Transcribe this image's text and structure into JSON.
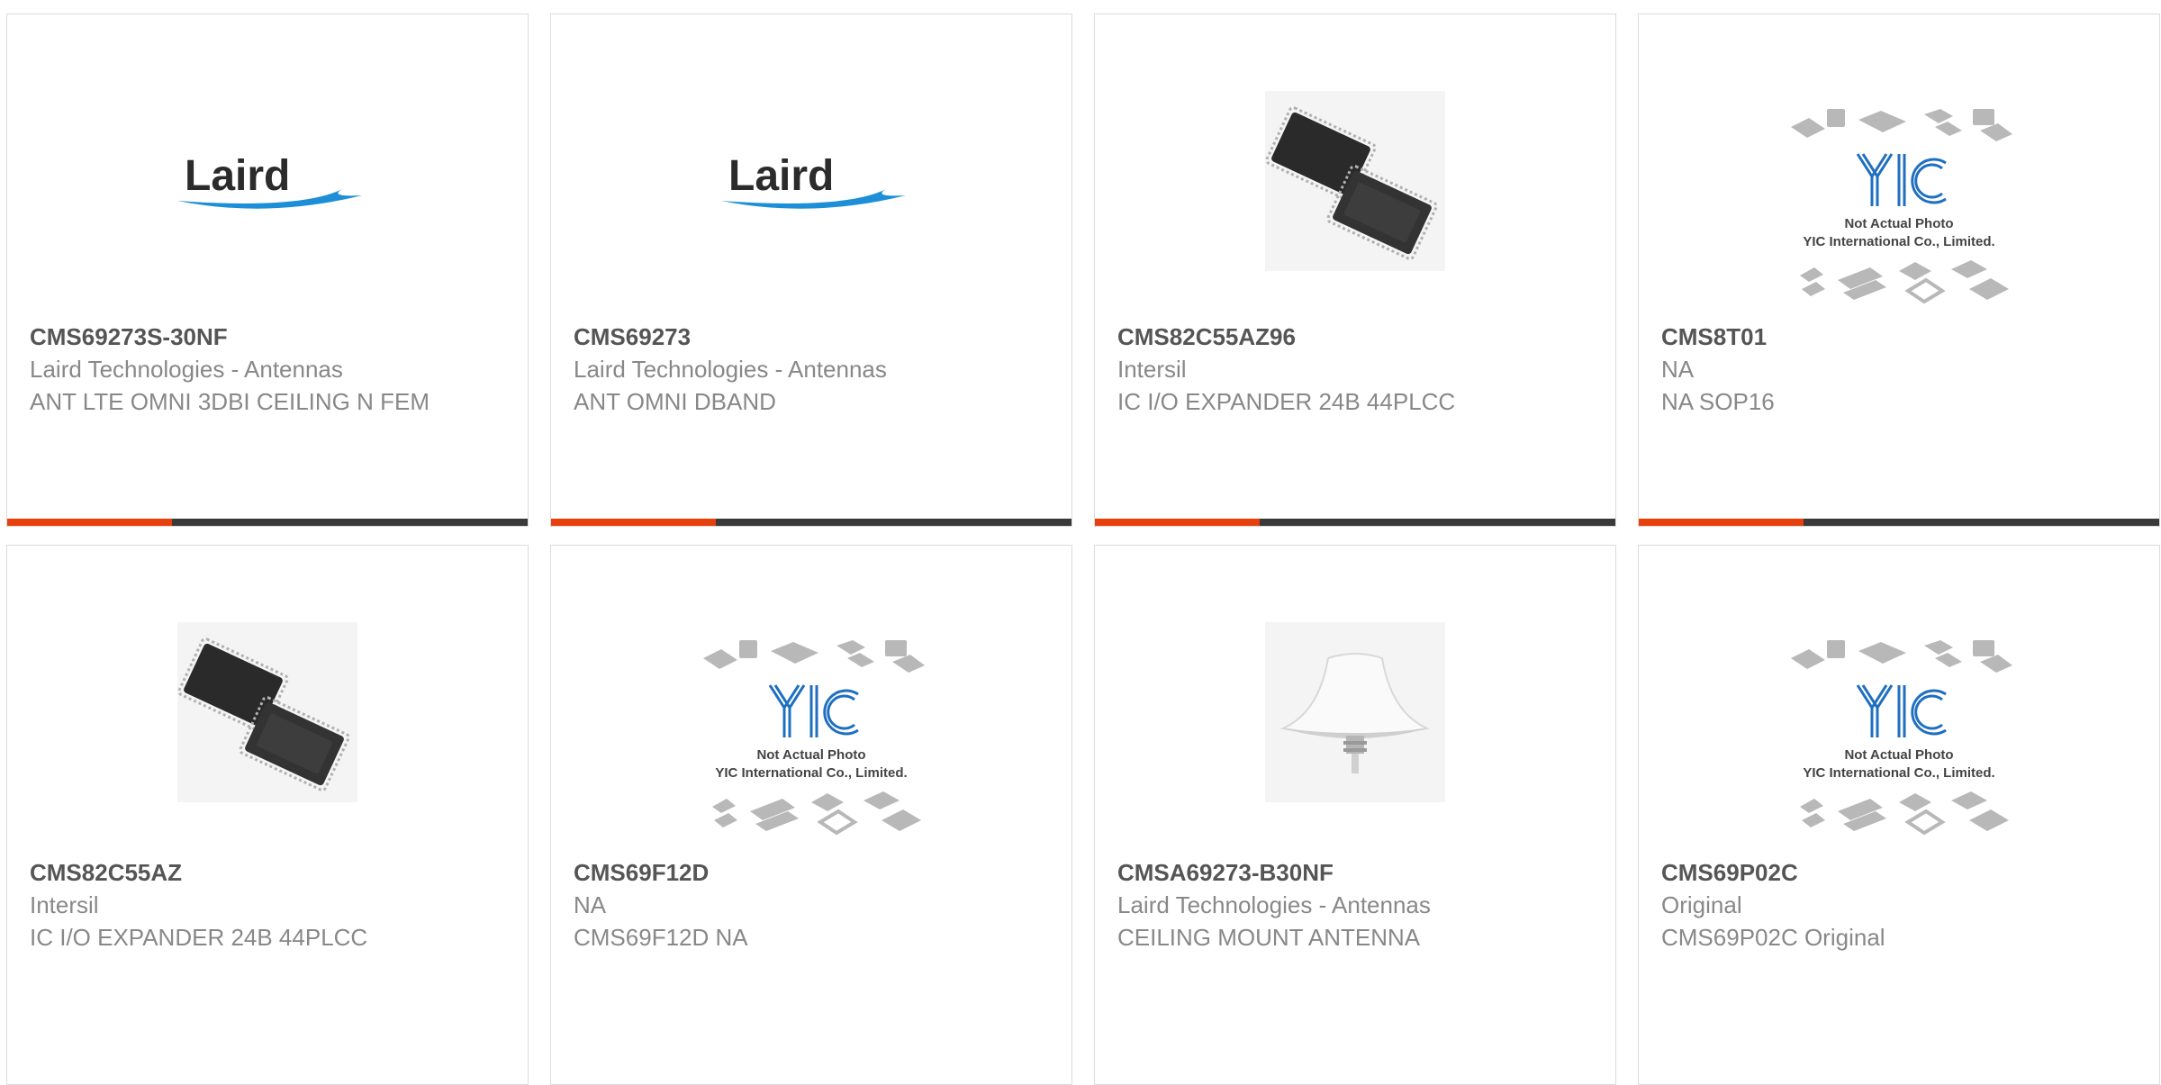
{
  "colors": {
    "accent": "#e8400c",
    "bar": "#3a3a3a",
    "title_text": "#555555",
    "body_text": "#888888",
    "card_border": "#dcdcdc"
  },
  "placeholder_image": {
    "line1": "Not Actual Photo",
    "line2": "YIC International Co., Limited.",
    "logo": "YIC"
  },
  "laird_logo": "Laird",
  "products": [
    {
      "part_number": "CMS69273S-30NF",
      "manufacturer": "Laird Technologies - Antennas",
      "description": "ANT LTE OMNI 3DBI CEILING N FEM",
      "image": "laird-logo"
    },
    {
      "part_number": "CMS69273",
      "manufacturer": "Laird Technologies - Antennas",
      "description": "ANT OMNI DBAND",
      "image": "laird-logo"
    },
    {
      "part_number": "CMS82C55AZ96",
      "manufacturer": "Intersil",
      "description": "IC I/O EXPANDER 24B 44PLCC",
      "image": "plcc-chips"
    },
    {
      "part_number": "CMS8T01",
      "manufacturer": "NA",
      "description": "NA SOP16",
      "image": "not-actual-photo"
    },
    {
      "part_number": "CMS82C55AZ",
      "manufacturer": "Intersil",
      "description": "IC I/O EXPANDER 24B 44PLCC",
      "image": "plcc-chips"
    },
    {
      "part_number": "CMS69F12D",
      "manufacturer": "NA",
      "description": "CMS69F12D NA",
      "image": "not-actual-photo"
    },
    {
      "part_number": "CMSA69273-B30NF",
      "manufacturer": "Laird Technologies - Antennas",
      "description": "CEILING MOUNT ANTENNA",
      "image": "ceiling-antenna"
    },
    {
      "part_number": "CMS69P02C",
      "manufacturer": "Original",
      "description": "CMS69P02C Original",
      "image": "not-actual-photo"
    }
  ]
}
